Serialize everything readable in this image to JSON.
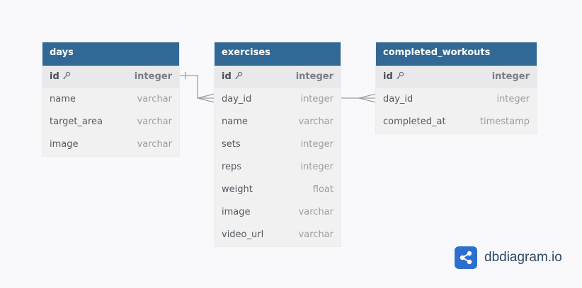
{
  "tables": {
    "days": {
      "name": "days",
      "columns": [
        {
          "name": "id",
          "type": "integer",
          "pk": true
        },
        {
          "name": "name",
          "type": "varchar"
        },
        {
          "name": "target_area",
          "type": "varchar"
        },
        {
          "name": "image",
          "type": "varchar"
        }
      ]
    },
    "exercises": {
      "name": "exercises",
      "columns": [
        {
          "name": "id",
          "type": "integer",
          "pk": true
        },
        {
          "name": "day_id",
          "type": "integer"
        },
        {
          "name": "name",
          "type": "varchar"
        },
        {
          "name": "sets",
          "type": "integer"
        },
        {
          "name": "reps",
          "type": "integer"
        },
        {
          "name": "weight",
          "type": "float"
        },
        {
          "name": "image",
          "type": "varchar"
        },
        {
          "name": "video_url",
          "type": "varchar"
        }
      ]
    },
    "completed_workouts": {
      "name": "completed_workouts",
      "columns": [
        {
          "name": "id",
          "type": "integer",
          "pk": true
        },
        {
          "name": "day_id",
          "type": "integer"
        },
        {
          "name": "completed_at",
          "type": "timestamp"
        }
      ]
    }
  },
  "relationships": [
    {
      "from": "days.id",
      "to": "exercises.day_id",
      "type": "one-to-many"
    },
    {
      "from": "exercises.day_id",
      "to": "completed_workouts.day_id",
      "type": "many-to-many"
    }
  ],
  "colors": {
    "header": "#316896",
    "pk_row": "#e9e9eb",
    "body": "#f1f1f2",
    "link": "#9a9ea4",
    "brand": "#2d6fd1"
  },
  "brand": {
    "text": "dbdiagram.io",
    "icon": "share-nodes-icon"
  }
}
